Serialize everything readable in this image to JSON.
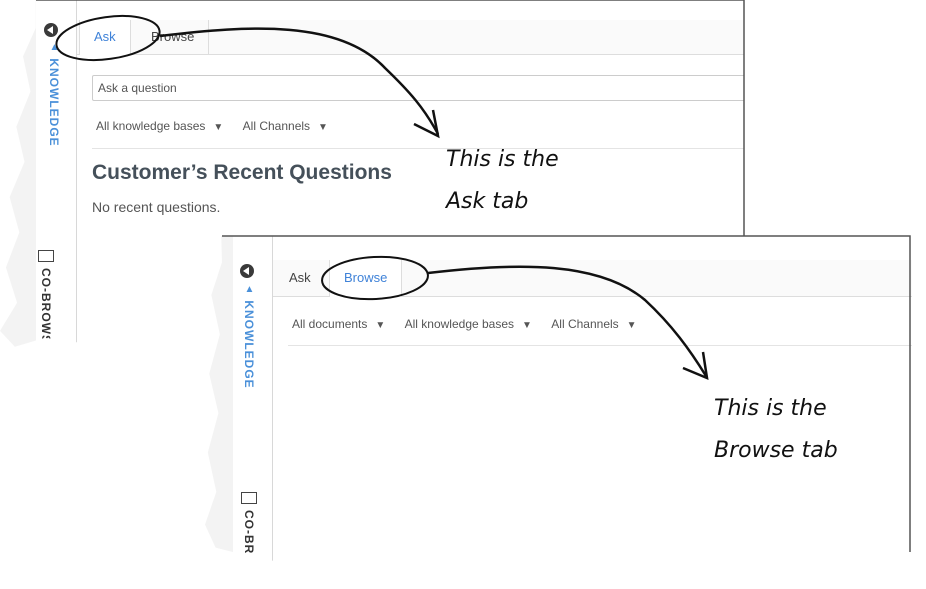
{
  "ask_panel": {
    "tabs": [
      {
        "label": "Ask",
        "active": true
      },
      {
        "label": "Browse",
        "active": false
      }
    ],
    "search_placeholder": "Ask a question",
    "filters": [
      "All knowledge bases",
      "All Channels"
    ],
    "section_title": "Customer’s Recent Questions",
    "empty_text": "No recent questions.",
    "rail_labels": [
      "KNOWLEDGE",
      "CO-BROWS"
    ]
  },
  "browse_panel": {
    "tabs": [
      {
        "label": "Ask",
        "active": false
      },
      {
        "label": "Browse",
        "active": true
      }
    ],
    "filters": [
      "All documents",
      "All knowledge bases",
      "All Channels"
    ],
    "rail_labels": [
      "KNOWLEDGE",
      "CO-BR"
    ]
  },
  "callouts": [
    {
      "line1": "This is the",
      "line2": "Ask tab"
    },
    {
      "line1": "This is the",
      "line2": "Browse tab"
    }
  ],
  "icons": {
    "collapse": "collapse-left-icon",
    "knowledge": "graduation-cap-icon",
    "cobrowse": "monitor-icon",
    "dropdown": "caret-down-icon"
  },
  "colors": {
    "accent": "#3f82d8",
    "heading": "#45505a",
    "rail_text": "#4a90d9"
  }
}
